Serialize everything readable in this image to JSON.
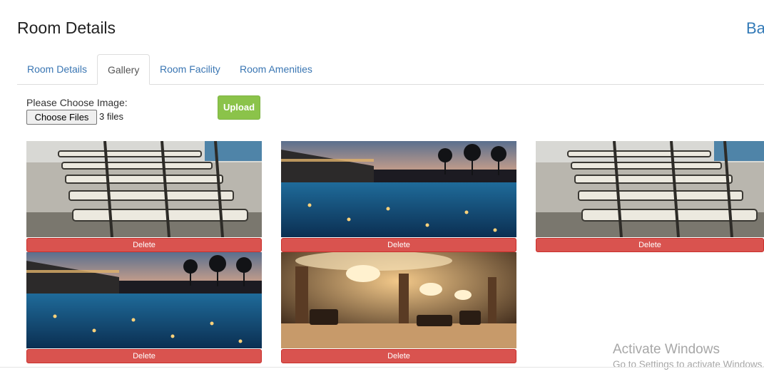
{
  "header": {
    "title": "Room Details",
    "back_label": "Ba"
  },
  "tabs": [
    {
      "label": "Room Details",
      "active": false
    },
    {
      "label": "Gallery",
      "active": true
    },
    {
      "label": "Room Facility",
      "active": false
    },
    {
      "label": "Room Amenities",
      "active": false
    }
  ],
  "upload": {
    "prompt": "Please Choose Image:",
    "choose_label": "Choose Files",
    "file_count": "3 files",
    "upload_label": "Upload"
  },
  "gallery": {
    "delete_label": "Delete",
    "items": [
      {
        "scene": "pool-loungers"
      },
      {
        "scene": "pool-night"
      },
      {
        "scene": "pool-loungers"
      },
      {
        "scene": "pool-night"
      },
      {
        "scene": "hotel-lobby"
      }
    ]
  },
  "watermark": {
    "title": "Activate Windows",
    "subtitle": "Go to Settings to activate Windows."
  },
  "colors": {
    "link": "#337ab7",
    "upload_green": "#8bc34a",
    "delete_red": "#d9534f"
  }
}
